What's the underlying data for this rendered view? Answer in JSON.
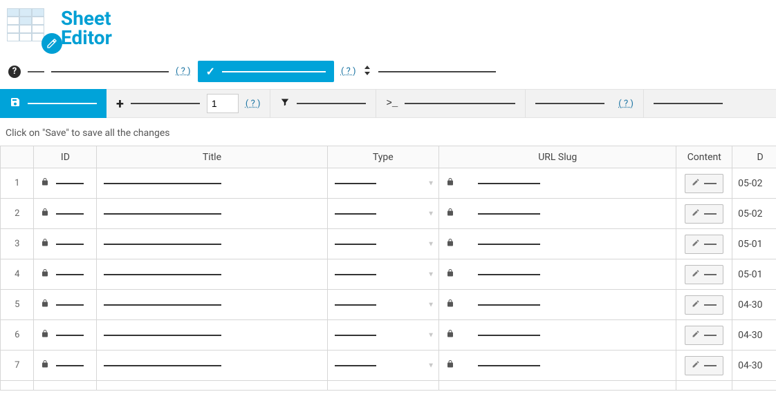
{
  "brand": {
    "line1": "Sheet",
    "line2": "Editor"
  },
  "topbar": {
    "help_link": "( ? )",
    "help_link2": "( ? )"
  },
  "toolbar": {
    "page_number": "1",
    "help_link": "( ? )",
    "help_link2": "( ? )"
  },
  "hint": "Click on \"Save\" to save all the changes",
  "columns": {
    "rownum": "",
    "id": "ID",
    "title": "Title",
    "type": "Type",
    "slug": "URL Slug",
    "content": "Content",
    "date": "D"
  },
  "rows": [
    {
      "n": "1",
      "date": "05-02"
    },
    {
      "n": "2",
      "date": "05-02"
    },
    {
      "n": "3",
      "date": "05-01"
    },
    {
      "n": "4",
      "date": "05-01"
    },
    {
      "n": "5",
      "date": "04-30"
    },
    {
      "n": "6",
      "date": "04-30"
    },
    {
      "n": "7",
      "date": "04-30"
    }
  ]
}
